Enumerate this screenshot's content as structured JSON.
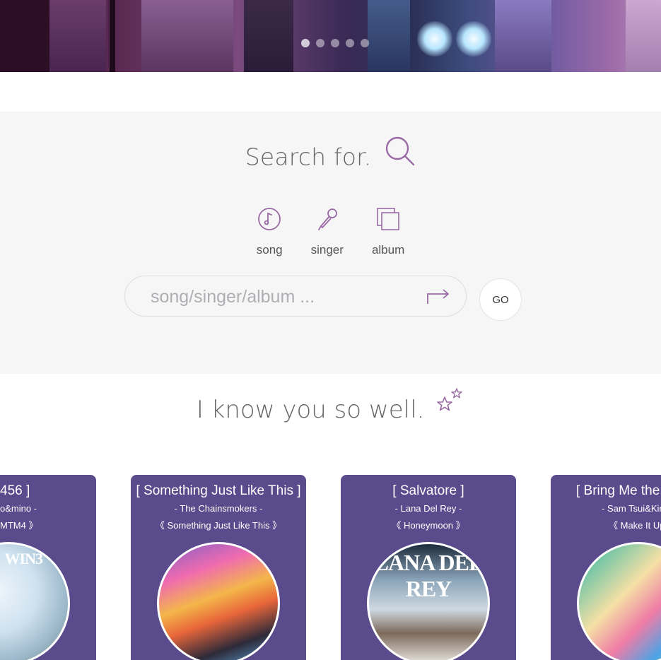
{
  "banner": {
    "slides": 5,
    "active_slide": 0
  },
  "search": {
    "title": "Search for.",
    "categories": [
      {
        "label": "song",
        "icon": "music-note-icon"
      },
      {
        "label": "singer",
        "icon": "microphone-icon"
      },
      {
        "label": "album",
        "icon": "album-stack-icon"
      }
    ],
    "input_placeholder": "song/singer/album ...",
    "go_label": "GO"
  },
  "recommend": {
    "title": "I know you so well.",
    "cards": [
      {
        "title": "456 ]",
        "singer": "o&mino -",
        "album": "MTM4 》"
      },
      {
        "title": "[ Something Just Like This ]",
        "singer": "- The Chainsmokers -",
        "album": "《 Something Just Like This 》"
      },
      {
        "title": "[ Salvatore ]",
        "singer": "- Lana Del Rey -",
        "album": "《 Honeymoon 》"
      },
      {
        "title": "[ Bring Me the",
        "singer": "- Sam Tsui&Kir",
        "album": "《 Make It Up"
      }
    ],
    "cover_labels": [
      "WIN3",
      "",
      "LANA DEL REY",
      ""
    ]
  },
  "colors": {
    "accent": "#9a6aa5",
    "card_bg": "#5a4b8c",
    "section_bg": "#f7f6f7"
  }
}
